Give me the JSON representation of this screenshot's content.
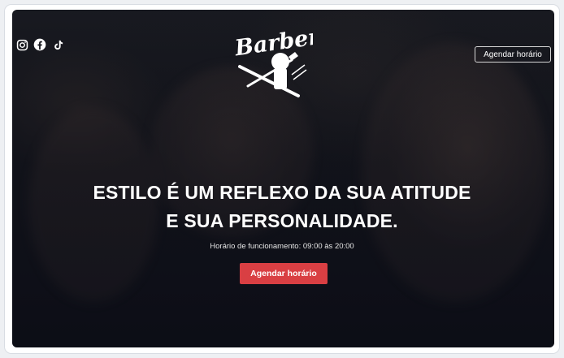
{
  "header": {
    "logo_text": "Barber",
    "social_icons": [
      "instagram-icon",
      "facebook-icon",
      "tiktok-icon"
    ],
    "cta_label": "Agendar horário"
  },
  "hero": {
    "headline_line1": "ESTILO É UM REFLEXO DA SUA ATITUDE",
    "headline_line2": "E SUA PERSONALIDADE.",
    "hours": "Horário de funcionamento: 09:00 às 20:00",
    "cta_label": "Agendar horário"
  },
  "colors": {
    "accent": "#d93f43",
    "overlay": "#0f1017",
    "text": "#ffffff"
  }
}
